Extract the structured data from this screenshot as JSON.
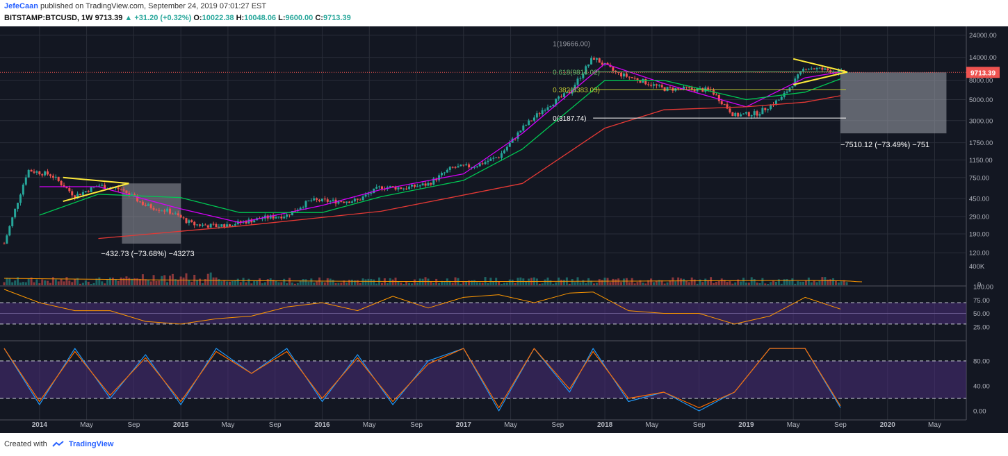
{
  "header": {
    "author": "JefeCaan",
    "published": "published on TradingView.com, September 24, 2019 07:01:27 EST",
    "symbol": "BITSTAMP:BTCUSD, 1W",
    "last": "9713.39",
    "change_arrow": "▲",
    "change": "+31.20 (+0.32%)",
    "o_label": "O:",
    "o": "10022.38",
    "h_label": "H:",
    "h": "10048.06",
    "l_label": "L:",
    "l": "9600.00",
    "c_label": "C:",
    "c": "9713.39"
  },
  "footer": {
    "created_with": "Created with",
    "brand": "TradingView"
  },
  "colors": {
    "background": "#131722",
    "grid": "#2a2e39",
    "up": "#26a69a",
    "down": "#ef5350",
    "ma_fast": "#d500f9",
    "ma_mid": "#00c853",
    "ma_slow": "#e53935",
    "triangle": "#ffeb3b",
    "rsi": "#ff9800",
    "stoch_k": "#2196f3",
    "stoch_d": "#ff6d00",
    "osc_band": "#4a2d7a",
    "volume_ma": "#ff9800",
    "price_tag": "#ef5350"
  },
  "chart_data": [
    {
      "type": "line",
      "title": "BITSTAMP:BTCUSD, 1W (candlestick)",
      "scale": "log",
      "ylim": [
        100,
        26000
      ],
      "x_ticks": [
        "2014",
        "May",
        "Sep",
        "2015",
        "May",
        "Sep",
        "2016",
        "May",
        "Sep",
        "2017",
        "May",
        "Sep",
        "2018",
        "May",
        "Sep",
        "2019",
        "May",
        "Sep",
        "2020",
        "May"
      ],
      "y_ticks": [
        "24000.00",
        "14000.00",
        "8000.00",
        "5000.00",
        "3000.00",
        "1750.00",
        "1150.00",
        "750.00",
        "450.00",
        "290.00",
        "190.00",
        "120.00"
      ],
      "price_label": "9713.39",
      "series": [
        {
          "name": "close",
          "x": [
            "2013-10",
            "2013-12",
            "2014-02",
            "2014-04",
            "2014-06",
            "2014-08",
            "2014-10",
            "2014-12",
            "2015-02",
            "2015-04",
            "2015-06",
            "2015-08",
            "2015-10",
            "2015-12",
            "2016-02",
            "2016-04",
            "2016-06",
            "2016-08",
            "2016-10",
            "2016-12",
            "2017-02",
            "2017-04",
            "2017-06",
            "2017-08",
            "2017-10",
            "2017-12",
            "2018-02",
            "2018-04",
            "2018-06",
            "2018-08",
            "2018-10",
            "2018-12",
            "2019-02",
            "2019-04",
            "2019-06",
            "2019-08",
            "2019-09"
          ],
          "values": [
            150,
            900,
            800,
            480,
            620,
            560,
            380,
            330,
            240,
            230,
            250,
            280,
            300,
            430,
            420,
            430,
            600,
            580,
            640,
            950,
            1000,
            1250,
            2500,
            4200,
            6000,
            14000,
            9500,
            8000,
            6500,
            6500,
            6300,
            3400,
            3600,
            5200,
            11000,
            10200,
            9713
          ]
        },
        {
          "name": "MA fast",
          "x": [
            "2014-01",
            "2014-06",
            "2015-01",
            "2015-06",
            "2016-01",
            "2016-06",
            "2017-01",
            "2017-06",
            "2018-01",
            "2018-06",
            "2019-01",
            "2019-06",
            "2019-09"
          ],
          "values": [
            600,
            600,
            350,
            250,
            380,
            560,
            820,
            2200,
            12000,
            7400,
            4200,
            8500,
            9800
          ]
        },
        {
          "name": "MA mid",
          "x": [
            "2014-01",
            "2014-06",
            "2015-01",
            "2015-06",
            "2016-01",
            "2016-06",
            "2017-01",
            "2017-06",
            "2018-01",
            "2018-06",
            "2019-01",
            "2019-06",
            "2019-09"
          ],
          "values": [
            300,
            500,
            460,
            320,
            320,
            470,
            700,
            1500,
            8000,
            8000,
            5000,
            6000,
            8300
          ]
        },
        {
          "name": "MA slow",
          "x": [
            "2014-06",
            "2015-06",
            "2016-06",
            "2017-06",
            "2018-01",
            "2018-06",
            "2019-01",
            "2019-06",
            "2019-09"
          ],
          "values": [
            170,
            230,
            330,
            650,
            2500,
            3900,
            4200,
            4700,
            5500
          ]
        }
      ],
      "fibonacci": [
        {
          "level": "1",
          "price": 19666.0,
          "label": "1(19666.00)"
        },
        {
          "level": "0.618",
          "price": 9814.02,
          "label": "0.618(9814.02)"
        },
        {
          "level": "0.382",
          "price": 6383.03,
          "label": "0.382(6383.03)"
        },
        {
          "level": "0",
          "price": 3187.74,
          "label": "0(3187.74)"
        }
      ],
      "measures": [
        {
          "label": "−432.73 (−73.68%) −43273",
          "from": "2014-08",
          "to": "2015-01",
          "top": 650,
          "bottom": 150
        },
        {
          "label": "−7510.12 (−73.49%) −751",
          "from": "2019-09",
          "to": "2020-06",
          "top": 9713.39,
          "bottom": 2200
        }
      ],
      "triangles": [
        {
          "from": "2014-03",
          "to": "2014-08",
          "upper": [
            750,
            650
          ],
          "lower": [
            420,
            650
          ]
        },
        {
          "from": "2019-05",
          "to": "2019-09",
          "upper": [
            13500,
            9800
          ],
          "lower": [
            7200,
            9800
          ]
        }
      ]
    },
    {
      "type": "bar",
      "title": "Volume",
      "y_ticks": [
        "400K",
        "0"
      ]
    },
    {
      "type": "line",
      "title": "RSI",
      "y_ticks": [
        "100.00",
        "75.00",
        "50.00",
        "25.00"
      ],
      "series": [
        {
          "name": "RSI",
          "x": [
            "2013-10",
            "2014-01",
            "2014-04",
            "2014-07",
            "2014-10",
            "2015-01",
            "2015-04",
            "2015-07",
            "2015-10",
            "2016-01",
            "2016-04",
            "2016-07",
            "2016-10",
            "2017-01",
            "2017-04",
            "2017-07",
            "2017-10",
            "2017-12",
            "2018-03",
            "2018-06",
            "2018-09",
            "2018-12",
            "2019-03",
            "2019-06",
            "2019-09"
          ],
          "values": [
            95,
            70,
            55,
            55,
            35,
            30,
            40,
            45,
            62,
            70,
            55,
            82,
            60,
            80,
            85,
            70,
            88,
            90,
            55,
            50,
            50,
            30,
            45,
            80,
            58
          ]
        }
      ]
    },
    {
      "type": "line",
      "title": "Stochastic RSI",
      "y_ticks": [
        "80.00",
        "40.00",
        "0.00"
      ],
      "series": [
        {
          "name": "%K",
          "x": [
            "2013-10",
            "2014-01",
            "2014-04",
            "2014-07",
            "2014-10",
            "2015-01",
            "2015-04",
            "2015-07",
            "2015-10",
            "2016-01",
            "2016-04",
            "2016-07",
            "2016-10",
            "2017-01",
            "2017-04",
            "2017-07",
            "2017-10",
            "2017-12",
            "2018-03",
            "2018-06",
            "2018-09",
            "2018-12",
            "2019-03",
            "2019-06",
            "2019-09"
          ],
          "values": [
            100,
            10,
            100,
            20,
            90,
            10,
            100,
            60,
            100,
            15,
            90,
            10,
            80,
            100,
            0,
            100,
            30,
            100,
            15,
            30,
            0,
            30,
            100,
            100,
            5
          ]
        },
        {
          "name": "%D",
          "x": [
            "2013-10",
            "2014-01",
            "2014-04",
            "2014-07",
            "2014-10",
            "2015-01",
            "2015-04",
            "2015-07",
            "2015-10",
            "2016-01",
            "2016-04",
            "2016-07",
            "2016-10",
            "2017-01",
            "2017-04",
            "2017-07",
            "2017-10",
            "2017-12",
            "2018-03",
            "2018-06",
            "2018-09",
            "2018-12",
            "2019-03",
            "2019-06",
            "2019-09"
          ],
          "values": [
            100,
            15,
            95,
            25,
            85,
            15,
            95,
            60,
            95,
            20,
            85,
            15,
            75,
            100,
            5,
            100,
            35,
            95,
            20,
            30,
            5,
            30,
            100,
            100,
            8
          ]
        }
      ]
    }
  ]
}
